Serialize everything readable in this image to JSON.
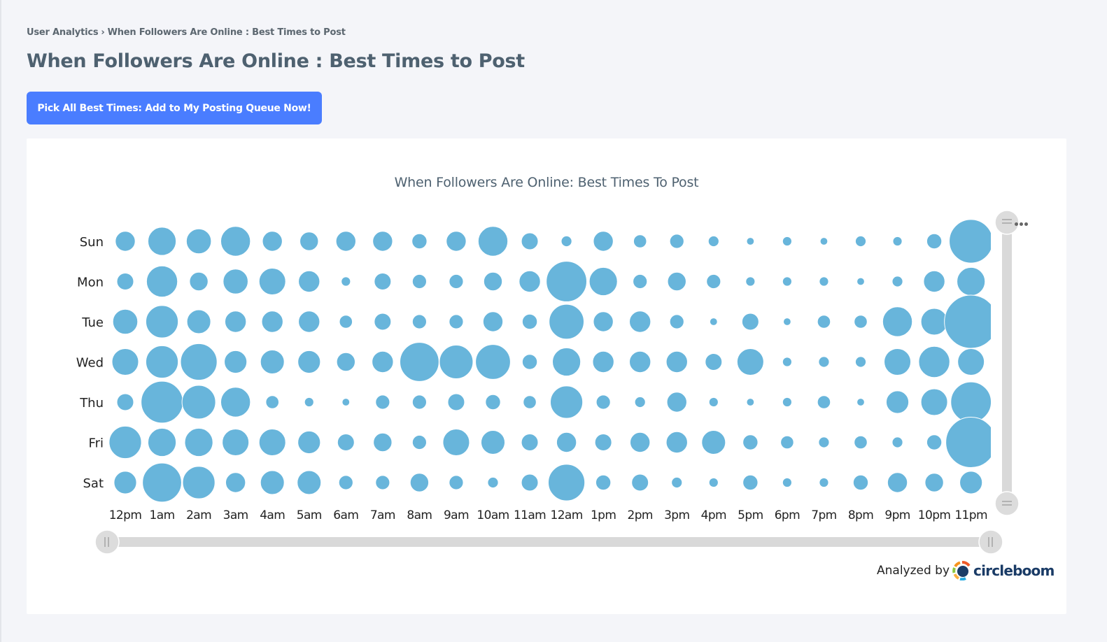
{
  "breadcrumb": {
    "items": [
      "User Analytics",
      "When Followers Are Online : Best Times to Post"
    ],
    "separator": "›"
  },
  "page_title": "When Followers Are Online : Best Times to Post",
  "cta_button": "Pick All Best Times: Add to My Posting Queue Now!",
  "colors": {
    "accent": "#4a7dff",
    "bubble": "#68b5db",
    "slider_track": "#d9d9d9",
    "slider_handle": "#dcdcdc"
  },
  "footer": {
    "analyzed_by": "Analyzed by",
    "brand": "circleboom"
  },
  "chart_data": {
    "type": "scatter",
    "subtype": "bubble",
    "title": "When Followers Are Online: Best Times To Post",
    "xlabel": "",
    "ylabel": "",
    "value_note": "relative follower activity (0-100), estimated from bubble area",
    "x_categories": [
      "12pm",
      "1am",
      "2am",
      "3am",
      "4am",
      "5am",
      "6am",
      "7am",
      "8am",
      "9am",
      "10am",
      "11am",
      "12am",
      "1pm",
      "2pm",
      "3pm",
      "4pm",
      "5pm",
      "6pm",
      "7pm",
      "8pm",
      "9pm",
      "10pm",
      "11pm"
    ],
    "y_categories": [
      "Sun",
      "Mon",
      "Tue",
      "Wed",
      "Thu",
      "Fri",
      "Sat"
    ],
    "values": [
      [
        14,
        28,
        22,
        31,
        14,
        12,
        14,
        14,
        8,
        14,
        31,
        10,
        4,
        14,
        6,
        7,
        4,
        2,
        3,
        2,
        4,
        3,
        8,
        67
      ],
      [
        10,
        34,
        12,
        22,
        25,
        16,
        3,
        10,
        7,
        7,
        12,
        16,
        58,
        28,
        7,
        12,
        7,
        3,
        3,
        3,
        2,
        4,
        16,
        28
      ],
      [
        22,
        37,
        20,
        16,
        16,
        16,
        6,
        10,
        7,
        7,
        14,
        8,
        43,
        14,
        16,
        7,
        2,
        10,
        2,
        6,
        6,
        31,
        25,
        100
      ],
      [
        25,
        37,
        47,
        18,
        20,
        18,
        12,
        16,
        54,
        40,
        43,
        8,
        28,
        16,
        16,
        16,
        10,
        25,
        3,
        4,
        4,
        25,
        34,
        25
      ],
      [
        10,
        62,
        40,
        31,
        6,
        3,
        2,
        7,
        7,
        10,
        8,
        6,
        37,
        7,
        4,
        14,
        3,
        2,
        3,
        6,
        2,
        18,
        25,
        58
      ],
      [
        37,
        28,
        28,
        25,
        25,
        18,
        10,
        12,
        7,
        25,
        20,
        10,
        14,
        10,
        14,
        16,
        20,
        8,
        6,
        4,
        6,
        4,
        8,
        90
      ],
      [
        18,
        54,
        37,
        14,
        20,
        20,
        7,
        7,
        12,
        7,
        4,
        10,
        47,
        8,
        10,
        4,
        3,
        8,
        3,
        3,
        8,
        14,
        12,
        18
      ]
    ],
    "grid": false,
    "legend": "none",
    "x_range_selector": {
      "start": "12pm",
      "end": "11pm"
    },
    "y_range_selector": {
      "start": "Sun",
      "end": "Sat"
    },
    "plot_clipped_after": "11pm"
  }
}
